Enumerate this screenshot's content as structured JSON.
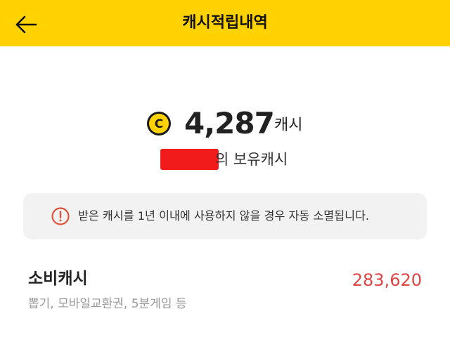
{
  "header": {
    "title": "캐시적립내역",
    "back_icon": "arrow-left-icon",
    "background": "#ffd200"
  },
  "balance": {
    "coin_icon": "cash-coin-icon",
    "coin_letter": "C",
    "amount": "4,287",
    "unit": "캐시"
  },
  "owner": {
    "suffix": "의 보유캐시"
  },
  "notice": {
    "icon": "exclamation-circle-icon",
    "text": "받은 캐시를 1년 이내에 사용하지 않을 경우 자동 소멸됩니다."
  },
  "spend": {
    "title": "소비캐시",
    "subtitle": "뽑기, 모바일교환권, 5분게임 등",
    "value": "283,620",
    "value_color": "#e04545"
  }
}
